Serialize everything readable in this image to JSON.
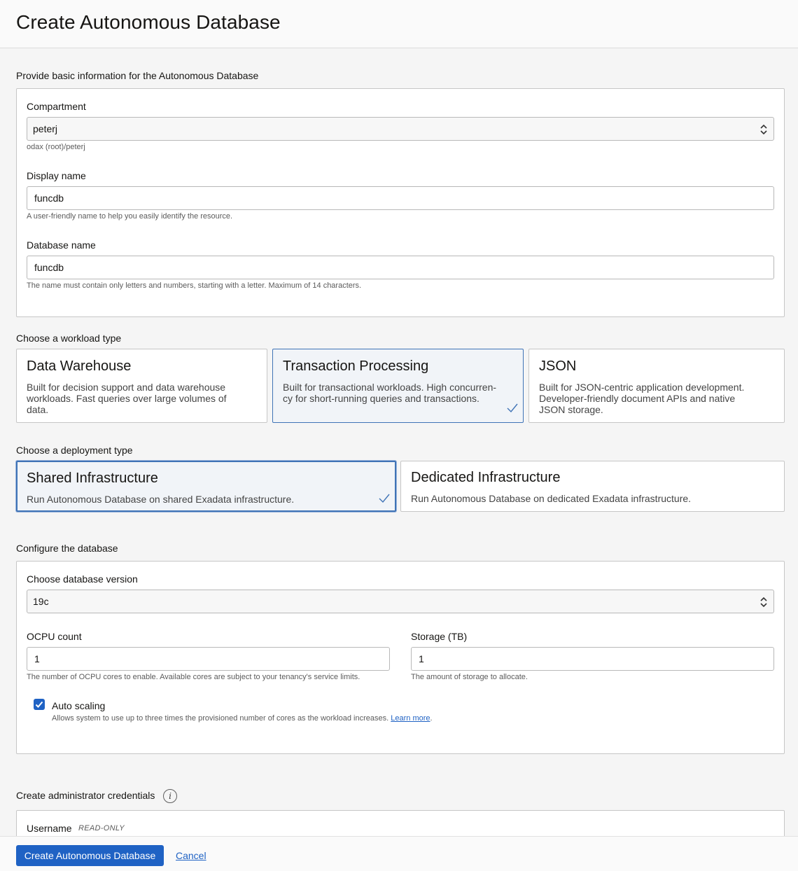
{
  "header": {
    "title": "Create Autonomous Database"
  },
  "basic_info": {
    "section_label": "Provide basic information for the Autonomous Database",
    "compartment": {
      "label": "Compartment",
      "value": "peterj",
      "help": "odax (root)/peterj"
    },
    "display_name": {
      "label": "Display name",
      "value": "funcdb",
      "help": "A user-friendly name to help you easily identify the resource."
    },
    "database_name": {
      "label": "Database name",
      "value": "funcdb",
      "help": "The name must contain only letters and numbers, starting with a letter. Maximum of 14 characters."
    }
  },
  "workload": {
    "section_label": "Choose a workload type",
    "options": [
      {
        "title": "Data Warehouse",
        "desc_lines": [
          "Built for decision support and data warehouse",
          "workloads. Fast queries over large volumes of",
          "data."
        ],
        "selected": false
      },
      {
        "title": "Transaction Processing",
        "desc_lines": [
          "Built for transactional workloads. High concurren-",
          "cy for short-running queries and transactions."
        ],
        "selected": true
      },
      {
        "title": "JSON",
        "desc_lines": [
          "Built for JSON-centric application development.",
          "Developer-friendly document APIs and native",
          "JSON storage."
        ],
        "selected": false
      }
    ]
  },
  "deployment": {
    "section_label": "Choose a deployment type",
    "options": [
      {
        "title": "Shared Infrastructure",
        "desc": "Run Autonomous Database on shared Exadata infrastructure.",
        "selected": true
      },
      {
        "title": "Dedicated Infrastructure",
        "desc": "Run Autonomous Database on dedicated Exadata infrastructure.",
        "selected": false
      }
    ]
  },
  "configure": {
    "section_label": "Configure the database",
    "version": {
      "label": "Choose database version",
      "value": "19c"
    },
    "ocpu": {
      "label": "OCPU count",
      "value": "1",
      "help": "The number of OCPU cores to enable. Available cores are subject to your tenancy's service limits."
    },
    "storage": {
      "label": "Storage (TB)",
      "value": "1",
      "help": "The amount of storage to allocate."
    },
    "auto_scaling": {
      "label": "Auto scaling",
      "checked": true,
      "help": "Allows system to use up to three times the provisioned number of cores as the workload increases.",
      "learn_more": "Learn more",
      "period": "."
    }
  },
  "admin": {
    "section_label": "Create administrator credentials",
    "info_icon": "i",
    "username_label": "Username",
    "username_badge": "READ-ONLY"
  },
  "footer": {
    "create_label": "Create Autonomous Database",
    "cancel_label": "Cancel"
  },
  "colors": {
    "accent": "#1f62c4",
    "selected_bg": "#f1f4f8",
    "selected_border": "#3f73b6"
  }
}
